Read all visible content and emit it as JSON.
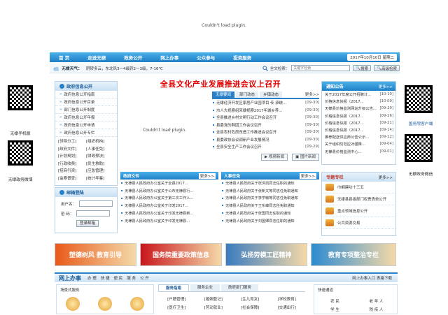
{
  "plugin_error": "Couldn't load plugin.",
  "nav": {
    "items": [
      "首 页",
      "走进无棣",
      "政务公开",
      "网上办事",
      "公众参与",
      "投资服务"
    ],
    "date": "2017年10月10日 星期二"
  },
  "weather": {
    "label": "无棣天气：",
    "text": "阴转多云，东北风3～4级转2～3级，7-16℃",
    "search_label": "全文检索：",
    "search_placeholder": "关键字检索",
    "search_button": "搜索",
    "advanced_button": "高级检索"
  },
  "left_qr": [
    {
      "caption": "无棣手机版"
    },
    {
      "caption": "无棣政务微博"
    }
  ],
  "right_qr": [
    {
      "caption": "国务院客户端"
    },
    {
      "caption": "无棣政务微信"
    }
  ],
  "info_panel": {
    "title": "政府信息公开",
    "items": [
      "政府信息公开指南",
      "政府信息公开目录",
      "部门信息公开制度",
      "政府信息公开年报",
      "政府信息公开申请",
      "政府信息公开专栏"
    ],
    "grid": [
      "[领导分工]",
      "[组织机构]",
      "[政府文件]",
      "[人事任免]",
      "[计划规划]",
      "[财政预决]",
      "[行政收费]",
      "[民生救助]",
      "[招商引资]",
      "[应急管理]",
      "[监察督查]",
      "[统计年鉴]"
    ]
  },
  "mail_panel": {
    "title": "邮箱登陆",
    "user_label": "用户名：",
    "password_label": "密  码：",
    "login_button": "登录邮箱"
  },
  "headline": "全县文化产业发展推进会议上召开",
  "news": {
    "tabs": [
      "无棣要闻",
      "部门动态",
      "乡镇动态"
    ],
    "more": "更多>>",
    "items": [
      {
        "title": "无棣经济开发区家居产业园项目 传 承统...",
        "date": "[09-30]"
      },
      {
        "title": "市人大视察组来棣视察2017年城乡养...",
        "date": "[09-30]"
      },
      {
        "title": "全县推进乡村文明行动工作会议召开",
        "date": "[09-30]"
      },
      {
        "title": "县委党的群团工作会议召开",
        "date": "[09-30]"
      },
      {
        "title": "全县农村危房改造工作推进会议召开",
        "date": "[09-30]"
      },
      {
        "title": "县委政协会议调研产业发展情况",
        "date": "[09-30]"
      },
      {
        "title": "全县安全生产工作会议召开",
        "date": "[09-29]"
      }
    ],
    "video_button": "视频新闻",
    "photo_button": "图片新闻"
  },
  "notice": {
    "title": "通知公告",
    "more": "更多>>",
    "items": [
      {
        "title": "关于2017年度公开招聘计...",
        "date": "[10-10]"
      },
      {
        "title": "价格信息快报（2017...",
        "date": "[10-09]"
      },
      {
        "title": "无棣县价格监测网站升级公告...",
        "date": "[09-29]"
      },
      {
        "title": "价格信息快报（2017...",
        "date": "[09-26]"
      },
      {
        "title": "价格信息快报（2017...",
        "date": "[09-21]"
      },
      {
        "title": "价格信息快报（2017...",
        "date": "[09-14]"
      },
      {
        "title": "推荐配送供应商公告公示...",
        "date": "[09-12]"
      },
      {
        "title": "关于组织防范应对强降...",
        "date": "[09-04]"
      },
      {
        "title": "无棣县价格监测中心...",
        "date": "[09-01]"
      }
    ]
  },
  "gov_files": {
    "title": "政府文件",
    "more": "更多>>",
    "items": [
      "无棣县人民政府办公室关于全县2017...",
      "无棣县人民政府办公室关于公布无棣县行...",
      "无棣县人民政府办公室关于第三次工作人...",
      "无棣县人民政府办公室关于印发2017...",
      "无棣县人民政府办公室关于印发无棣县新...",
      "无棣县人民政府办公室关于印发无棣县..."
    ]
  },
  "personnel": {
    "title": "人事任免",
    "more": "更多>>",
    "items": [
      "无棣县人民政府关于张洪凯同志任职的通知",
      "无棣县人民政府关于张新文等同志任免职通知",
      "无棣县人民政府关于李学敏等同志任免职通知",
      "无棣县人民政府关于王东峰同志任免职通知",
      "无棣县人民政府关于张国同志任职的通知",
      "无棣县人民政府关于刘国卿同志任职的通知"
    ]
  },
  "topics": {
    "title": "专题专栏",
    "more": "更多>>",
    "items": [
      "巾帼建功十三五",
      "无棣县县级部门权责清单公开",
      "重点领域信息公开",
      "公共资源交易"
    ]
  },
  "banners": [
    {
      "text": "塑德树风 教育引导",
      "color": "#e85a1a"
    },
    {
      "text": "国务院重要政策信息",
      "color": "#c8161d"
    },
    {
      "text": "弘扬劳模工匠精神",
      "color": "#3a7bbf"
    },
    {
      "text": "教育专项整治专栏",
      "color": "#2c8bd0"
    }
  ],
  "bottom": {
    "title": "网上办事",
    "links": [
      "办 理",
      "快 捷",
      "便 民",
      "服 务",
      "公 开"
    ],
    "right": "网上办事入口  表格下载",
    "scene_title": "场景式服务",
    "service_tabs": [
      "服务指南",
      "服务企业",
      "政府部门服务"
    ],
    "service_items": [
      "[户籍管理]",
      "[婚姻登记]",
      "[生儿育女]",
      "[学校教育]",
      "[医疗卫生]",
      "[劳动就业]",
      "[社会保障]",
      "[交通出行]"
    ],
    "person_title": "快速通道",
    "person_items": [
      "农 民",
      "老 年 人",
      "学 生",
      "残 疾 人"
    ]
  }
}
